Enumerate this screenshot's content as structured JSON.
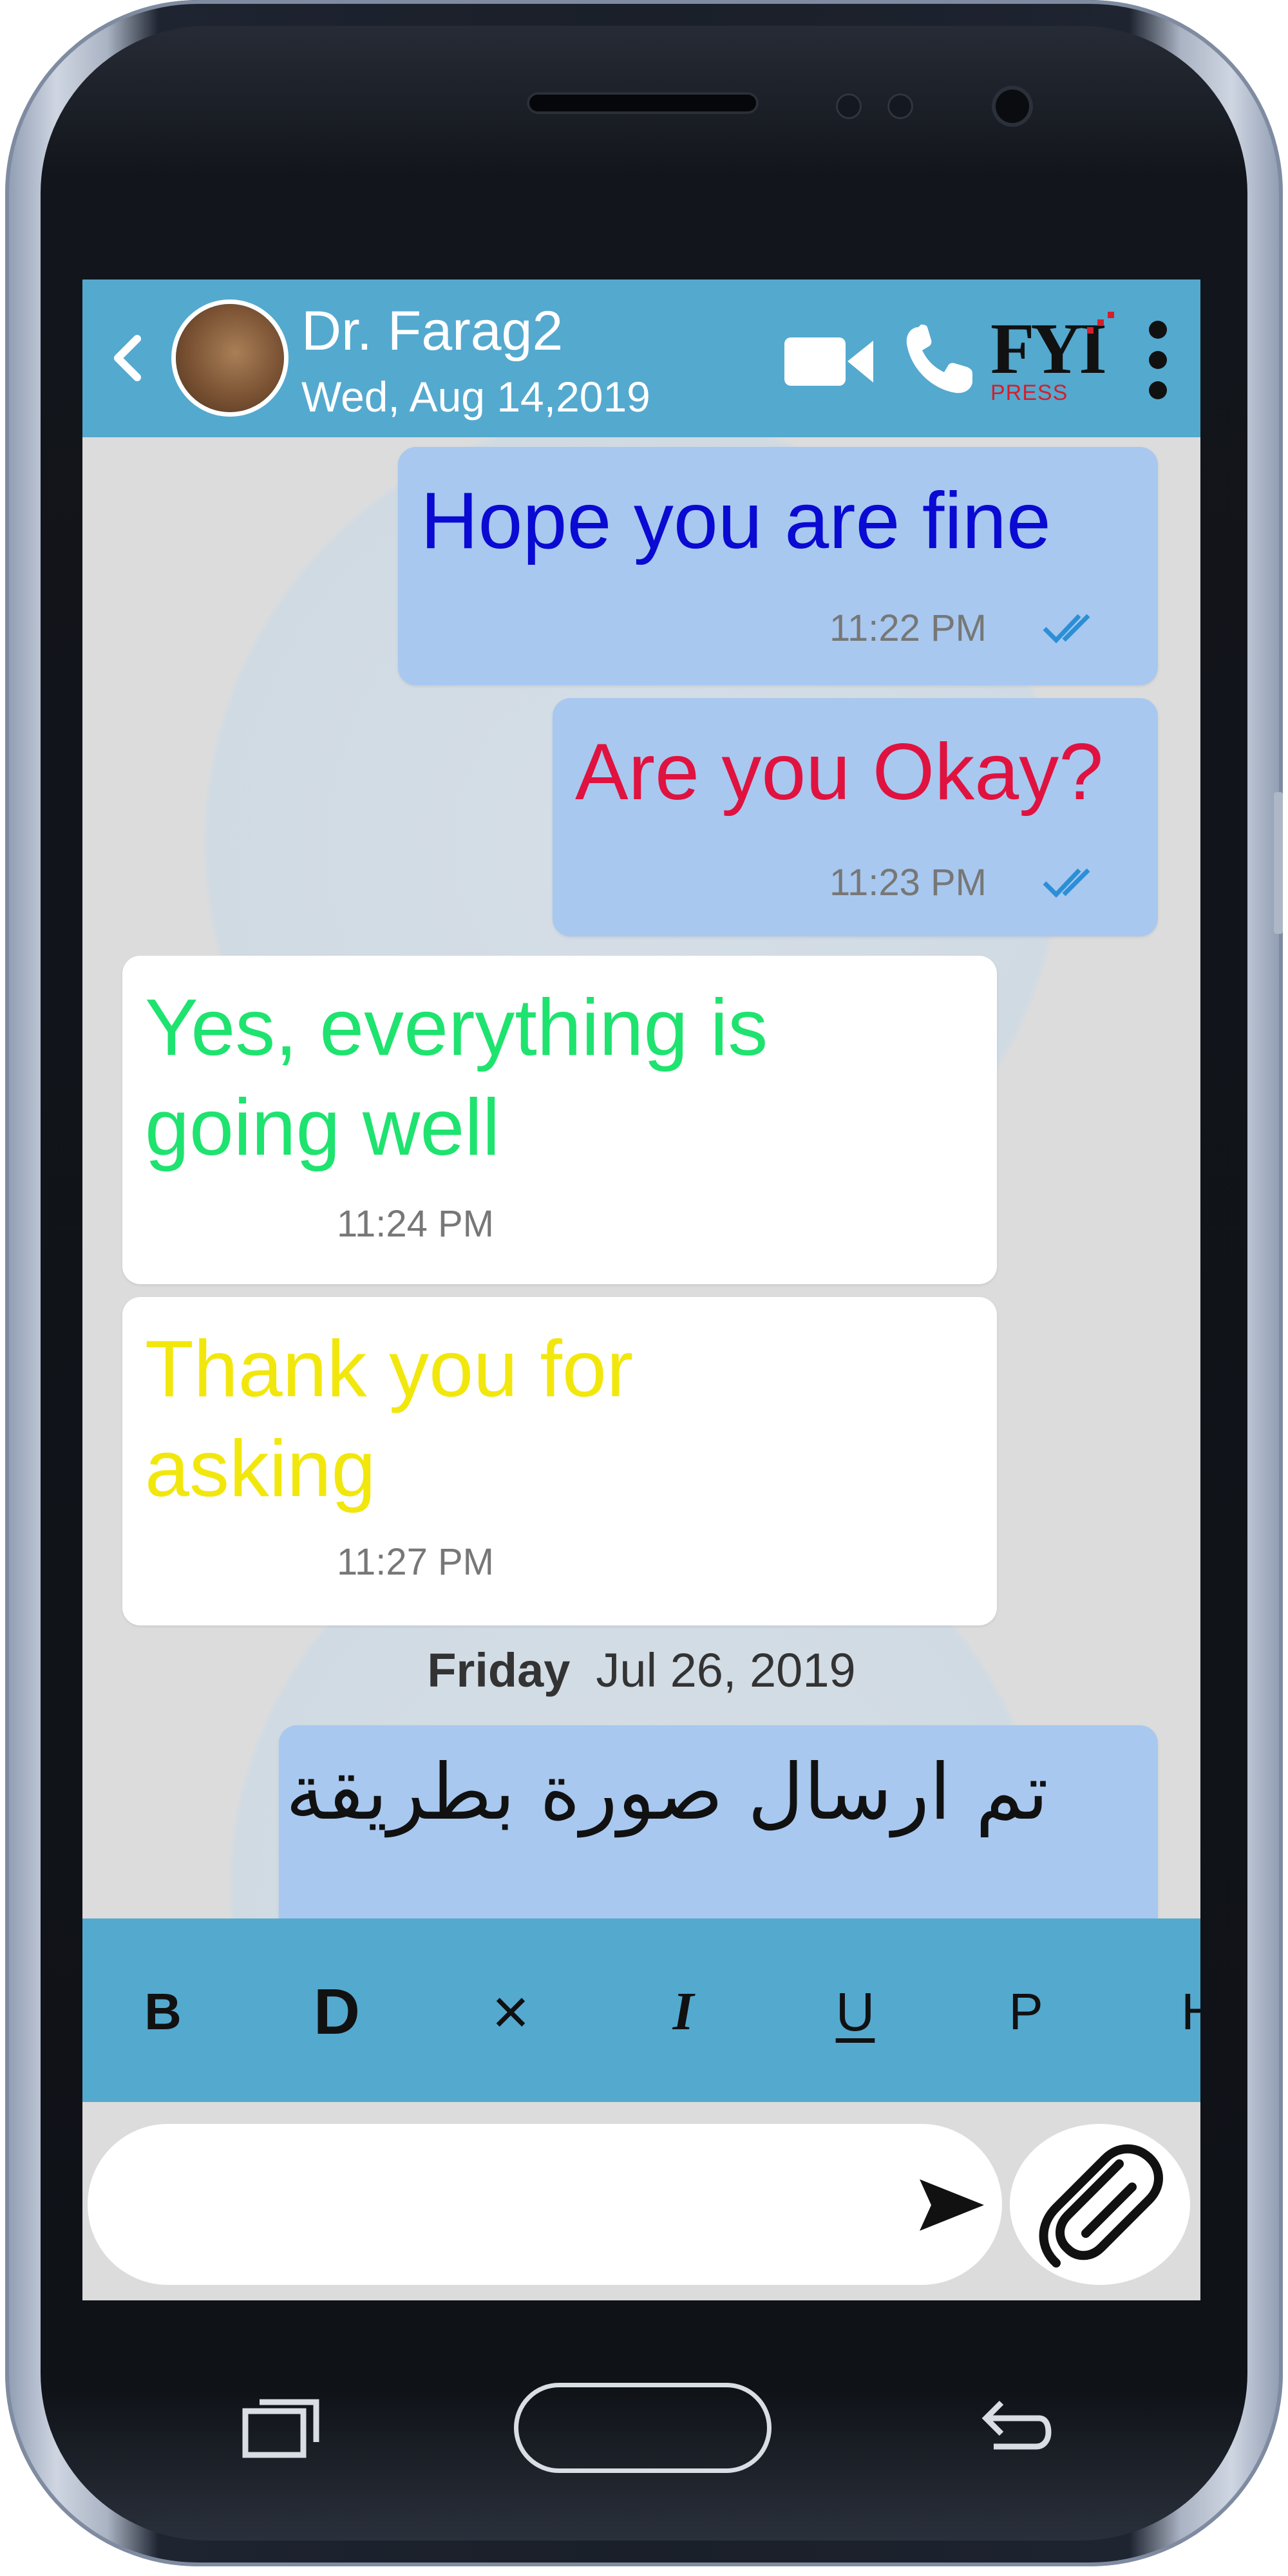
{
  "header": {
    "contact_name": "Dr. Farag2",
    "contact_date": "Wed, Aug 14,2019",
    "icons": [
      "back-arrow-icon",
      "video-call-icon",
      "phone-call-icon",
      "more-vert-icon"
    ],
    "logo": {
      "main": "FYI",
      "sub": "PRESS"
    }
  },
  "messages": [
    {
      "direction": "outgoing",
      "text": "Hope you are fine",
      "time": "11:22 PM",
      "color": "#0a0ad2",
      "status": "read"
    },
    {
      "direction": "outgoing",
      "text": "Are you Okay?",
      "time": "11:23 PM",
      "color": "#e0123f",
      "status": "read"
    },
    {
      "direction": "incoming",
      "text_line1": "Yes, everything is",
      "text_line2": "going well",
      "time": "11:24 PM",
      "color": "#1ee36f"
    },
    {
      "direction": "incoming",
      "text_line1": "Thank you for",
      "text_line2": "asking",
      "time": "11:27 PM",
      "color": "#f2e70c"
    },
    {
      "direction": "outgoing",
      "text": "تم ارسال صورة بطريقة",
      "color": "#111111"
    }
  ],
  "date_separator": {
    "day": "Friday",
    "date": "Jul 26, 2019"
  },
  "format_toolbar": {
    "buttons": [
      "B",
      "D",
      "×",
      "I",
      "U",
      "P",
      "H"
    ]
  },
  "composer": {
    "value": "",
    "icons": [
      "send-icon",
      "attach-paperclip-icon"
    ]
  },
  "colors": {
    "header_bg": "#54a9cf",
    "outgoing_bubble": "#a8c8ef",
    "incoming_bubble": "#ffffff",
    "tick_color": "#2c8fd6"
  }
}
